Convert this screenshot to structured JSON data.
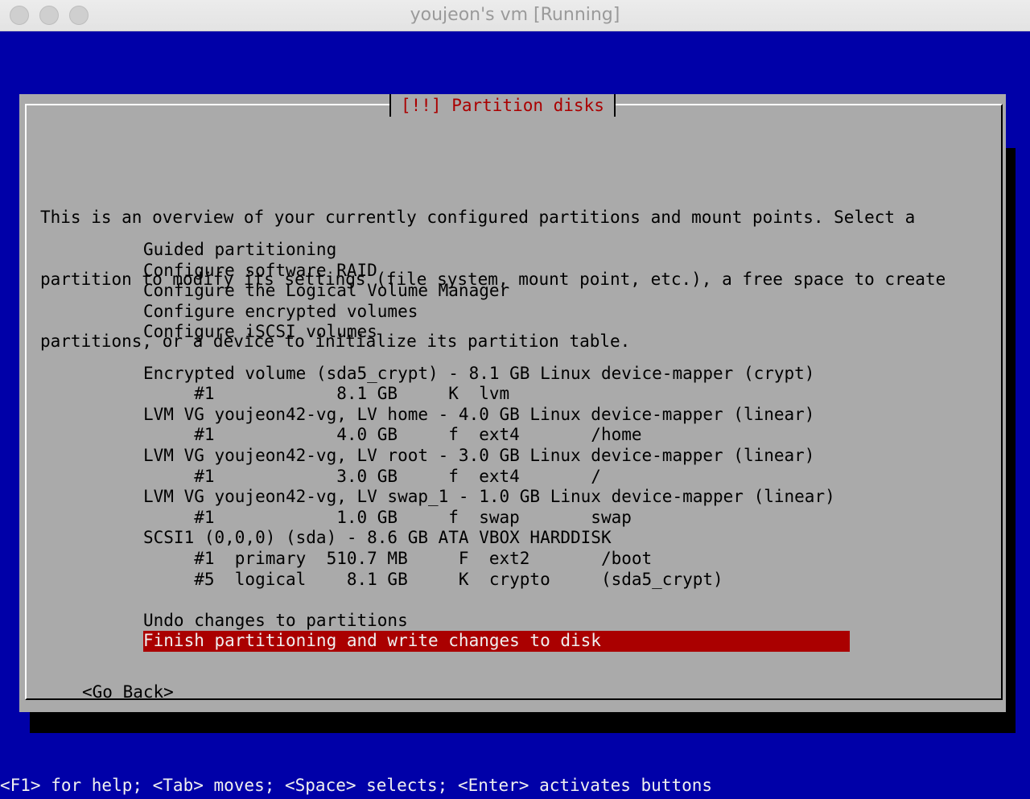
{
  "window": {
    "title": "youjeon's vm [Running]"
  },
  "dialog": {
    "title": "[!!] Partition disks",
    "intro": [
      "This is an overview of your currently configured partitions and mount points. Select a",
      "partition to modify its settings (file system, mount point, etc.), a free space to create",
      "partitions, or a device to initialize its partition table."
    ],
    "menu": [
      "Guided partitioning",
      "Configure software RAID",
      "Configure the Logical Volume Manager",
      "Configure encrypted volumes",
      "Configure iSCSI volumes",
      "",
      "Encrypted volume (sda5_crypt) - 8.1 GB Linux device-mapper (crypt)",
      "     #1            8.1 GB     K  lvm",
      "LVM VG youjeon42-vg, LV home - 4.0 GB Linux device-mapper (linear)",
      "     #1            4.0 GB     f  ext4       /home",
      "LVM VG youjeon42-vg, LV root - 3.0 GB Linux device-mapper (linear)",
      "     #1            3.0 GB     f  ext4       /",
      "LVM VG youjeon42-vg, LV swap_1 - 1.0 GB Linux device-mapper (linear)",
      "     #1            1.0 GB     f  swap       swap",
      "SCSI1 (0,0,0) (sda) - 8.6 GB ATA VBOX HARDDISK",
      "     #1  primary  510.7 MB     F  ext2       /boot",
      "     #5  logical    8.1 GB     K  crypto     (sda5_crypt)",
      "",
      "Undo changes to partitions",
      "Finish partitioning and write changes to disk"
    ],
    "selected_index": 19,
    "go_back_label": "<Go Back>"
  },
  "help_bar": "<F1> for help; <Tab> moves; <Space> selects; <Enter> activates buttons",
  "colors": {
    "screen_bg": "#0000a8",
    "dialog_bg": "#aaaaaa",
    "title_red": "#aa0000",
    "selection_bg": "#aa0000"
  }
}
